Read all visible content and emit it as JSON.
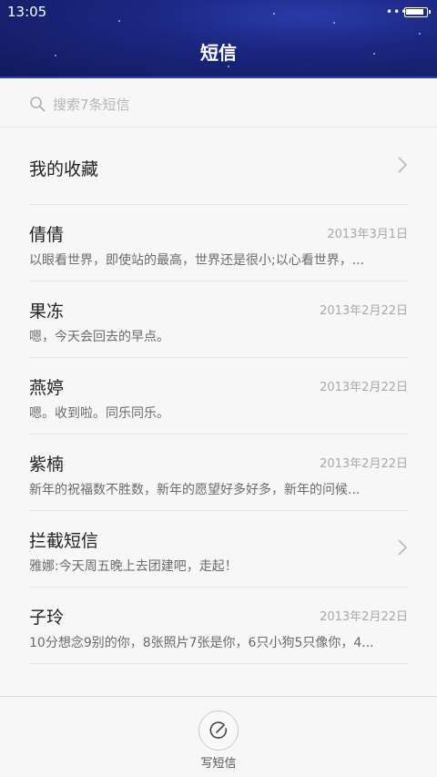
{
  "status_bar": {
    "time": "13:05",
    "signal": "•••",
    "battery_level": 0.95
  },
  "header": {
    "title": "短信"
  },
  "search": {
    "placeholder": "搜索7条短信"
  },
  "favorites": {
    "label": "我的收藏"
  },
  "conversations": [
    {
      "name": "倩倩",
      "date": "2013年3月1日",
      "preview": "以眼看世界，即使站的最高，世界还是很小;以心看世界，..."
    },
    {
      "name": "果冻",
      "date": "2013年2月22日",
      "preview": "嗯，今天会回去的早点。"
    },
    {
      "name": "燕婷",
      "date": "2013年2月22日",
      "preview": "嗯。收到啦。同乐同乐。"
    },
    {
      "name": "紫楠",
      "date": "2013年2月22日",
      "preview": "新年的祝福数不胜数，新年的愿望好多好多，新年的问候..."
    }
  ],
  "blocked": {
    "label": "拦截短信",
    "preview": "雅娜:今天周五晚上去团建吧，走起！"
  },
  "last_conversation": {
    "name": "子玲",
    "date": "2013年2月22日",
    "preview": "10分想念9别的你，8张照片7张是你，6只小狗5只像你，4..."
  },
  "bottom": {
    "compose_label": "写短信"
  }
}
